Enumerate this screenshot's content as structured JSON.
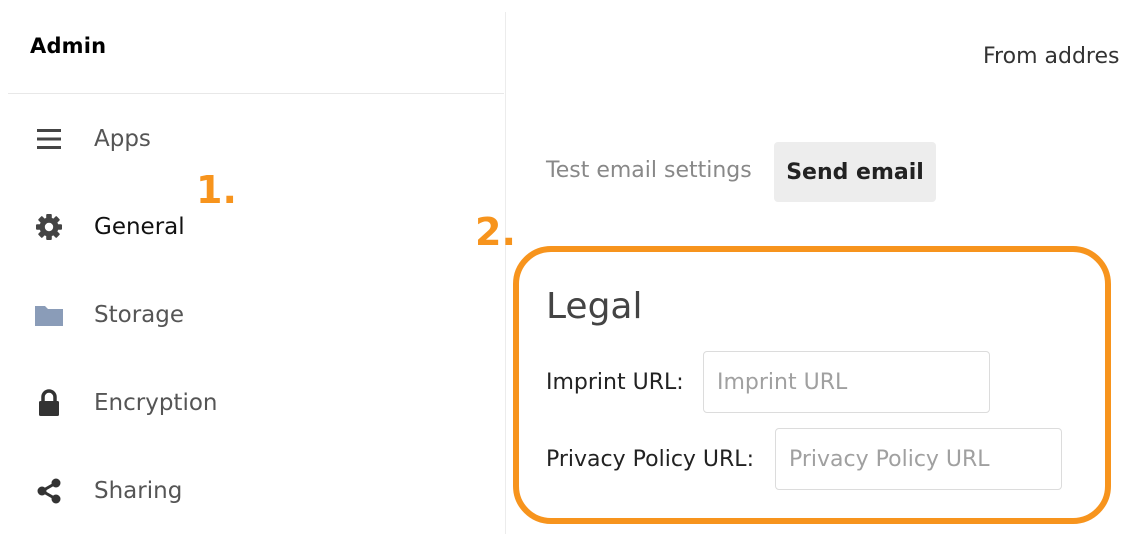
{
  "sidebar": {
    "title": "Admin",
    "items": [
      {
        "label": "Apps",
        "icon": "menu-icon"
      },
      {
        "label": "General",
        "icon": "gear-icon"
      },
      {
        "label": "Storage",
        "icon": "folder-icon"
      },
      {
        "label": "Encryption",
        "icon": "lock-icon"
      },
      {
        "label": "Sharing",
        "icon": "share-icon"
      }
    ]
  },
  "main": {
    "from_address_label": "From addres",
    "test_email_label": "Test email settings",
    "send_email_button": "Send email",
    "legal": {
      "title": "Legal",
      "imprint_label": "Imprint URL:",
      "imprint_placeholder": "Imprint URL",
      "imprint_value": "",
      "privacy_label": "Privacy Policy URL:",
      "privacy_placeholder": "Privacy Policy URL",
      "privacy_value": ""
    }
  },
  "annotations": {
    "step1": "1.",
    "step2": "2."
  },
  "colors": {
    "annotation_orange": "#f7941d",
    "button_bg": "#ededed"
  }
}
